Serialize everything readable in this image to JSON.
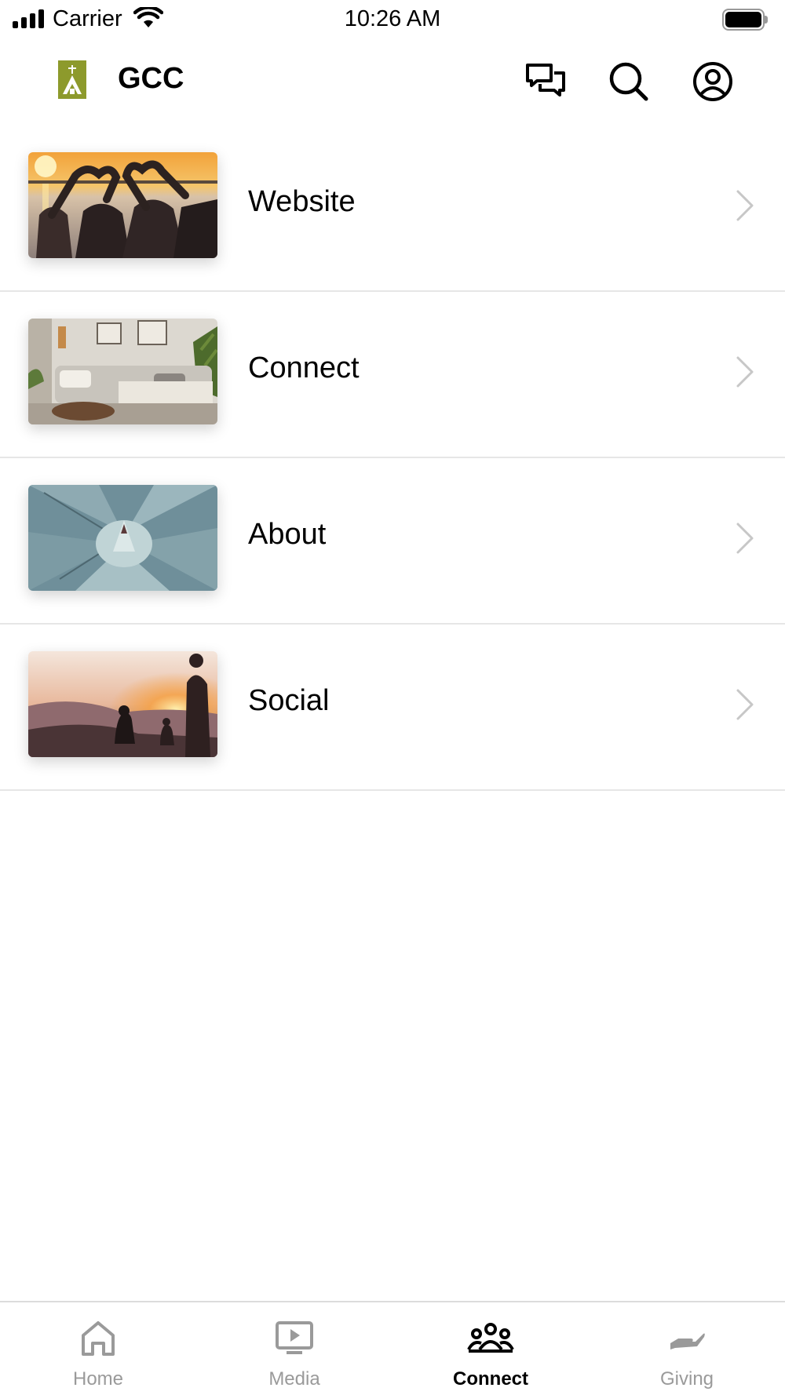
{
  "status_bar": {
    "carrier": "Carrier",
    "time": "10:26 AM"
  },
  "header": {
    "title": "GCC",
    "logo_color": "#8d9a2c"
  },
  "menu": {
    "items": [
      {
        "label": "Website",
        "thumb_icon": "sunset-heart-hands-photo"
      },
      {
        "label": "Connect",
        "thumb_icon": "living-room-sofa-photo"
      },
      {
        "label": "About",
        "thumb_icon": "agave-succulent-photo"
      },
      {
        "label": "Social",
        "thumb_icon": "sunset-hikers-photo"
      }
    ]
  },
  "tabbar": {
    "tabs": [
      {
        "label": "Home",
        "icon": "home-icon",
        "active": false
      },
      {
        "label": "Media",
        "icon": "play-screen-icon",
        "active": false
      },
      {
        "label": "Connect",
        "icon": "people-icon",
        "active": true
      },
      {
        "label": "Giving",
        "icon": "giving-hand-icon",
        "active": false
      }
    ]
  },
  "colors": {
    "active_tab": "#000000",
    "inactive_tab": "#9a9a9a",
    "chevron": "#c7c7c7",
    "divider": "#e6e6e6"
  }
}
